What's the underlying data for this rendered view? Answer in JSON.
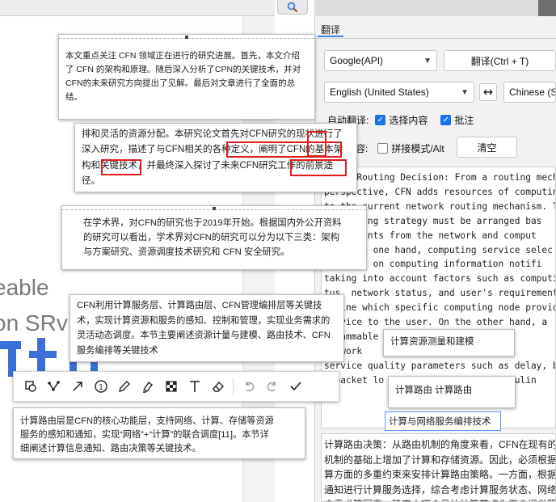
{
  "document": {
    "bg_text_1": "eable",
    "bg_text_2": "on SRv",
    "accent_blue": "#3a6fd8"
  },
  "cards": {
    "c1": "本文重点关注 CFN 领域正在进行的研究进展。首先，本文介绍\n了 CFN 的架构和原理。随后深入分析了CPN的关键技术，并对\nCFN的未来研究方向提出了见解。最后对文章进行了全面的总\n结。",
    "c2": "排和灵活的资源分配。本研究论文首先对CFN研究的现状进行了\n深入研究，描述了与CFN相关的各种定义，阐明了CFN的基本架\n构和关键技术，并最终深入探讨了未来CFN研究工作的前景途\n径。",
    "c3": "在学术界，对CFN的研究也于2019年开始。根据国内外公开资料\n的研究可以看出，学术界对CFN的研究可以分为以下三类：架构\n与方案研究、资源调度技术研究和 CFN 安全研究。",
    "c4": "CFN利用计算服务层、计算路由层、CFN管理编排层等关键技\n术，实现计算资源和服务的感知、控制和管理，实现业务需求的\n灵活动态调度。本节主要阐述资源计量与建模、路由技术、CFN\n服务编排等关键技术",
    "c5": "计算路由层是CFN的核心功能层，支持网络、计算、存储等资源\n服务的感知和通知，实现“网络”+“计算”的联合调度[11]。本节详\n细阐述计算信息通知、路由决策等关键技术。",
    "mini1": "计算资源测量和建模",
    "mini2": "计算路由 计算路由",
    "mini3": "计算与网络服务编排技术"
  },
  "panel": {
    "tab_label": "翻译",
    "engine": "Google(API)",
    "translate_button": "翻译(Ctrl + T)",
    "source_lang": "English (United States)",
    "target_lang": "Chinese (S",
    "swap_icon": "swap-arrows-icon",
    "auto_translate_label": "自动翻译:",
    "select_content_label": "选择内容",
    "select_content_checked": true,
    "annotation_label": "批注",
    "annotation_checked": true,
    "mode_label_partial": "容:",
    "concat_mode_label": "拼接模式/Alt",
    "concat_mode_checked": false,
    "clear_button": "清空",
    "accent": "#1a73e8"
  },
  "source_text": "uting Routing Decision: From a routing mech\nperspective, CFN adds resources of computing and\nto the current network routing mechanism. Theref\nng routing strategy must be arranged bas\nconstraints from the network and comput\n. On the one hand, computing service selec\ned based on computing information notifi\ntaking into account factors such as computing serv\ntus, network status, and user's requirement to\nermine which specific computing node provide\nservice to the user. On the other hand, a\nogrammable          is constr\nnetwork          ed based o\nservice quality parameters such as delay, bandwidt\nd packet lo                    chedulin",
  "target_text": "计算路由决策：从路由机制的角度来看，CFN在现有的\n机制的基础上增加了计算和存储资源。因此，必须根据\n算方面的多重约束来安排计算路由策略。一方面，根据\n通知进行计算服务选择，综合考虑计算服务状态、网络\n户需求等因素，确定由哪个具体计算节点为用户提供服",
  "toolbar": {
    "tools": [
      "lasso-icon",
      "polyline-icon",
      "arrow-icon",
      "number-marker-icon",
      "pen-icon",
      "highlighter-icon",
      "mosaic-icon",
      "text-icon",
      "eraser-icon"
    ],
    "actions": [
      "undo-icon",
      "redo-icon",
      "confirm-icon"
    ]
  }
}
